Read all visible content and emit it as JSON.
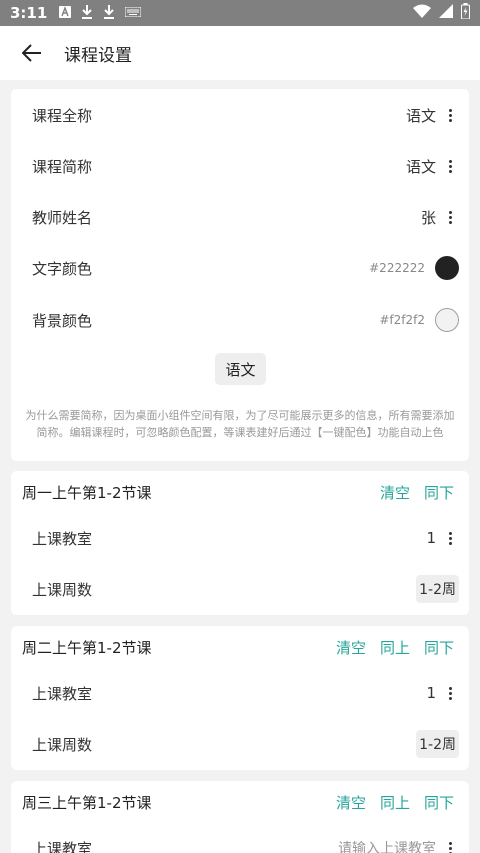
{
  "status_bar": {
    "time": "3:11"
  },
  "app_bar": {
    "title": "课程设置"
  },
  "course": {
    "full_name_label": "课程全称",
    "full_name_value": "语文",
    "short_name_label": "课程简称",
    "short_name_value": "语文",
    "teacher_label": "教师姓名",
    "teacher_value": "张",
    "text_color_label": "文字颜色",
    "text_color_value": "#222222",
    "bg_color_label": "背景颜色",
    "bg_color_value": "#f2f2f2",
    "preview_label": "语文",
    "hint": "为什么需要简称，因为桌面小组件空间有限，为了尽可能展示更多的信息，所有需要添加简称。编辑课程时，可忽略颜色配置，等课表建好后通过【一键配色】功能自动上色"
  },
  "sections": [
    {
      "title": "周一上午第1-2节课",
      "actions": [
        "清空",
        "同下"
      ],
      "classroom_label": "上课教室",
      "classroom_value": "1",
      "weeks_label": "上课周数",
      "weeks_value": "1-2周"
    },
    {
      "title": "周二上午第1-2节课",
      "actions": [
        "清空",
        "同上",
        "同下"
      ],
      "classroom_label": "上课教室",
      "classroom_value": "1",
      "weeks_label": "上课周数",
      "weeks_value": "1-2周"
    },
    {
      "title": "周三上午第1-2节课",
      "actions": [
        "清空",
        "同上",
        "同下"
      ],
      "classroom_label": "上课教室",
      "classroom_placeholder": "请输入上课教室"
    }
  ],
  "colors": {
    "accent": "#26a69a",
    "status_bar": "#808080"
  }
}
